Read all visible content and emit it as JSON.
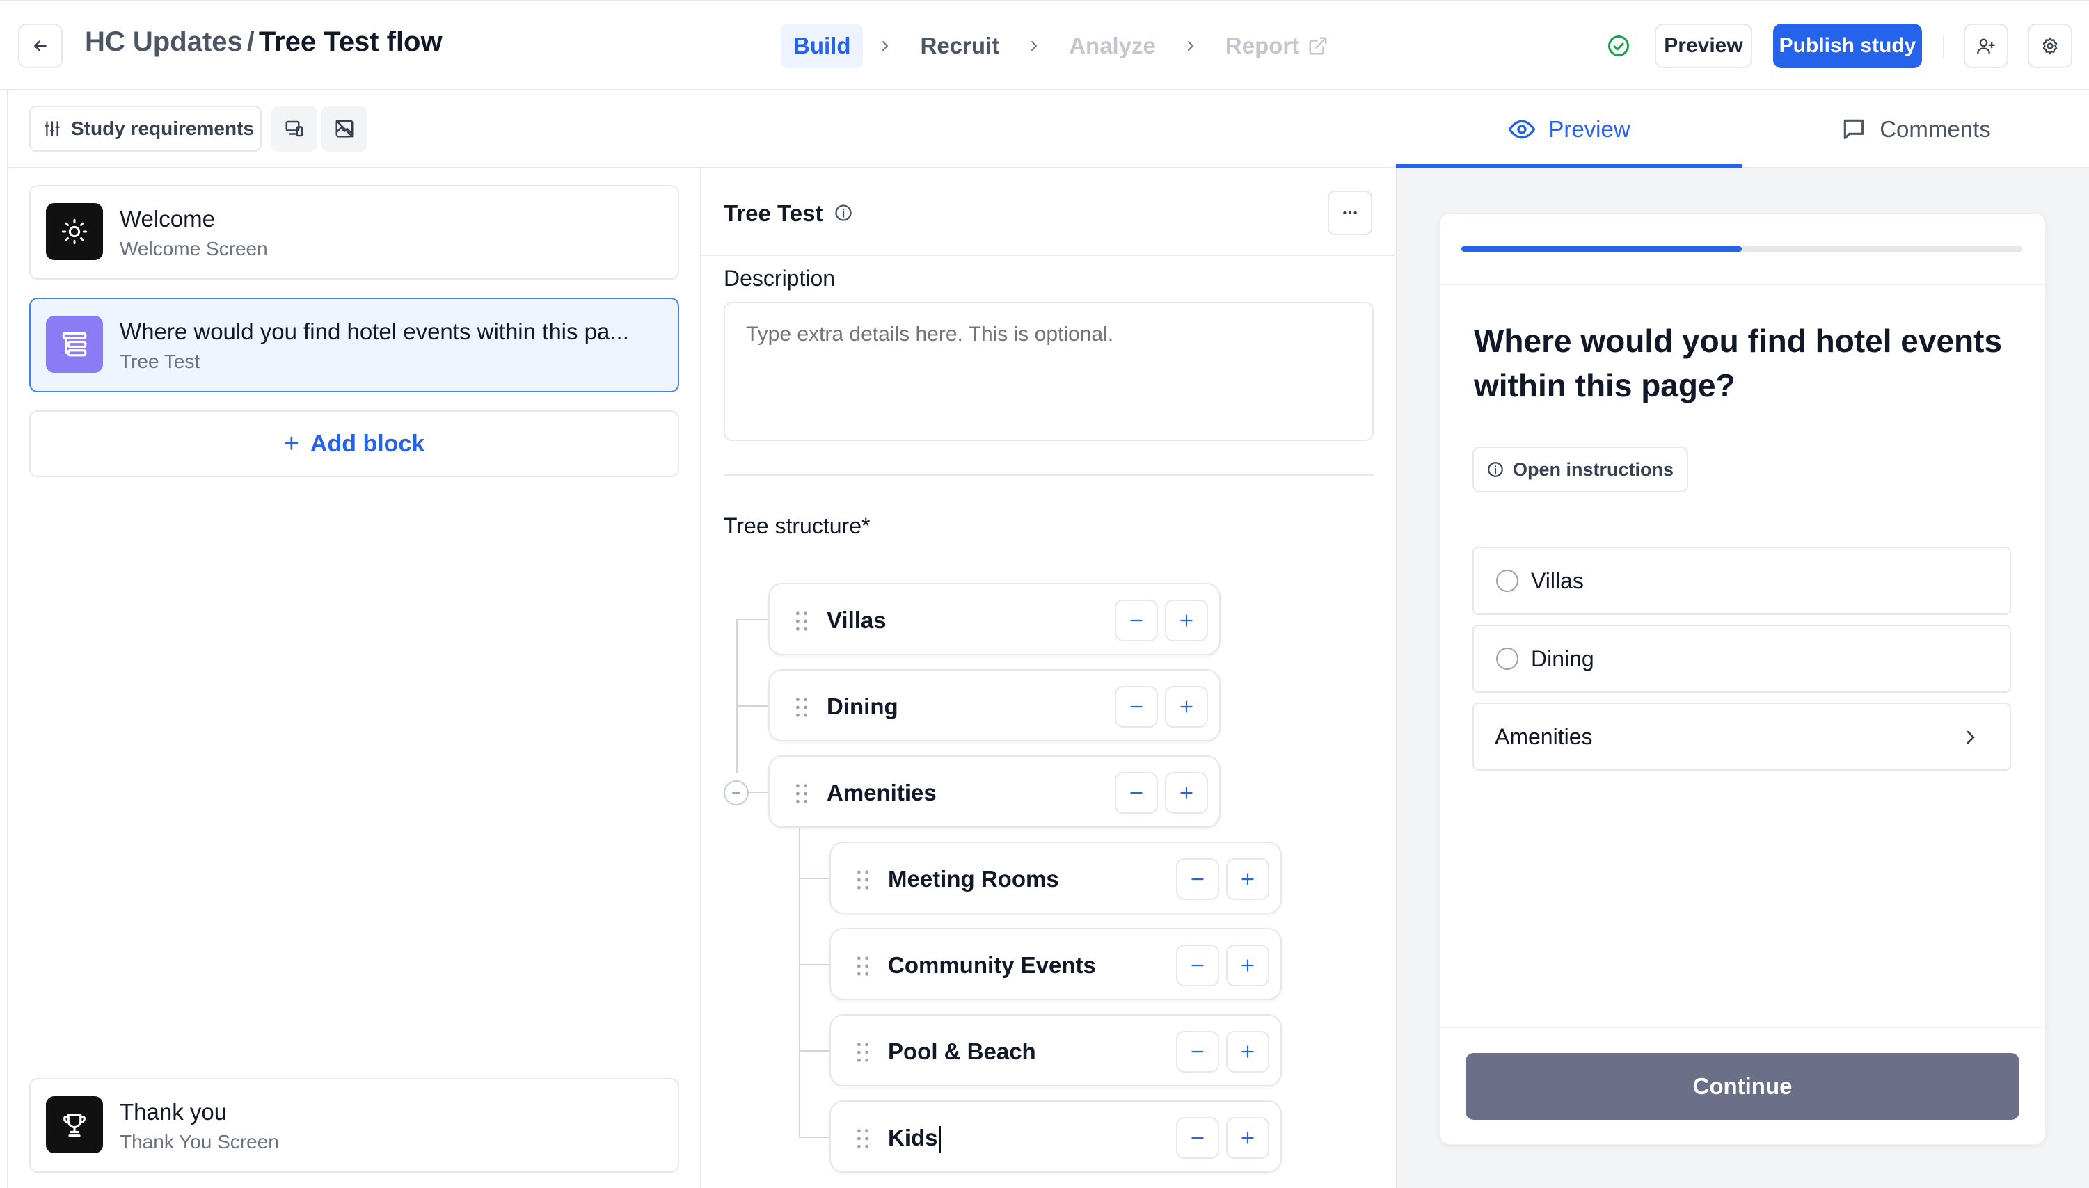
{
  "header": {
    "back_icon": "arrow-left-icon",
    "project": "HC Updates",
    "separator": "/",
    "flow_name": "Tree Test flow",
    "steps": [
      {
        "label": "Build",
        "state": "active"
      },
      {
        "label": "Recruit",
        "state": "normal"
      },
      {
        "label": "Analyze",
        "state": "disabled"
      },
      {
        "label": "Report",
        "state": "disabled",
        "icon": "external-link-icon"
      }
    ],
    "status_icon": "check-circle-icon",
    "preview_label": "Preview",
    "publish_label": "Publish study",
    "invite_icon": "user-plus-icon",
    "settings_icon": "gear-icon",
    "accent": "#2563eb"
  },
  "toolbar": {
    "requirements_label": "Study requirements",
    "requirements_icon": "sliders-icon",
    "device_icon": "devices-icon",
    "image_off_icon": "image-off-icon"
  },
  "blocks": [
    {
      "title": "Welcome",
      "subtitle": "Welcome Screen",
      "icon": "sun-icon"
    },
    {
      "title": "Where would you find hotel events within this pa...",
      "subtitle": "Tree Test",
      "icon": "tree-test-icon",
      "selected": true
    }
  ],
  "add_block_label": "Add block",
  "end_block": {
    "title": "Thank you",
    "subtitle": "Thank You Screen",
    "icon": "trophy-icon"
  },
  "editor": {
    "title": "Tree Test",
    "description_label": "Description",
    "description_placeholder": "Type extra details here. This is optional.",
    "tree_label": "Tree structure*",
    "nodes": [
      {
        "name": "Villas",
        "level": 0
      },
      {
        "name": "Dining",
        "level": 0
      },
      {
        "name": "Amenities",
        "level": 0,
        "expanded": true
      },
      {
        "name": "Meeting Rooms",
        "level": 1
      },
      {
        "name": "Community Events",
        "level": 1
      },
      {
        "name": "Pool & Beach",
        "level": 1
      },
      {
        "name": "Kids",
        "level": 1,
        "editing": true
      }
    ]
  },
  "preview_panel": {
    "tabs": [
      {
        "label": "Preview",
        "icon": "eye-icon",
        "active": true
      },
      {
        "label": "Comments",
        "icon": "comment-icon",
        "active": false
      }
    ],
    "progress": 0.5,
    "question": "Where would you find hotel events within this page?",
    "instructions_label": "Open instructions",
    "options": [
      {
        "label": "Villas",
        "type": "radio"
      },
      {
        "label": "Dining",
        "type": "radio"
      },
      {
        "label": "Amenities",
        "type": "folder"
      }
    ],
    "continue_label": "Continue"
  }
}
